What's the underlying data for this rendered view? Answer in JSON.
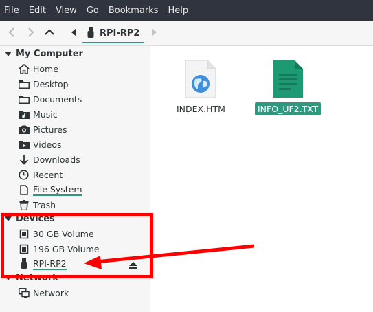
{
  "menubar": {
    "items": [
      "File",
      "Edit",
      "View",
      "Go",
      "Bookmarks",
      "Help"
    ]
  },
  "toolbar": {
    "breadcrumb_label": "RPI-RP2"
  },
  "sidebar": {
    "my_computer": {
      "title": "My Computer",
      "items": [
        {
          "label": "Home",
          "icon": "home-icon"
        },
        {
          "label": "Desktop",
          "icon": "folder-icon"
        },
        {
          "label": "Documents",
          "icon": "folder-icon"
        },
        {
          "label": "Music",
          "icon": "music-icon"
        },
        {
          "label": "Pictures",
          "icon": "camera-icon"
        },
        {
          "label": "Videos",
          "icon": "video-icon"
        },
        {
          "label": "Downloads",
          "icon": "download-arrow-icon"
        },
        {
          "label": "Recent",
          "icon": "clock-icon"
        },
        {
          "label": "File System",
          "icon": "file-icon"
        },
        {
          "label": "Trash",
          "icon": "trash-icon"
        }
      ]
    },
    "devices": {
      "title": "Devices",
      "items": [
        {
          "label": "30 GB Volume",
          "icon": "drive-chip-icon"
        },
        {
          "label": "196 GB Volume",
          "icon": "drive-chip-icon"
        },
        {
          "label": "RPI-RP2",
          "icon": "usb-drive-icon"
        }
      ]
    },
    "network": {
      "title": "Network",
      "items": [
        {
          "label": "Network",
          "icon": "network-icon"
        }
      ]
    }
  },
  "files": [
    {
      "name": "INDEX.HTM",
      "icon": "web-page-icon"
    },
    {
      "name": "INFO_UF2.TXT",
      "icon": "text-document-icon",
      "selected": true
    }
  ],
  "colors": {
    "accent": "#2d9a7f",
    "menubar_bg": "#2f343f",
    "annotation": "#ff0000"
  }
}
